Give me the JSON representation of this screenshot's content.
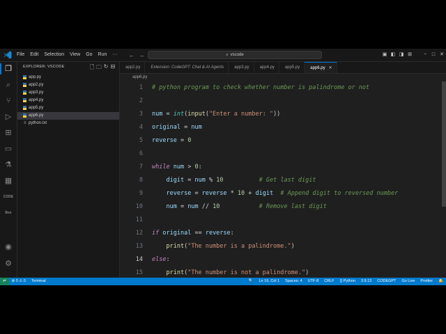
{
  "titlebar": {
    "menu": [
      "File",
      "Edit",
      "Selection",
      "View",
      "Go",
      "Run",
      "···"
    ],
    "search_text": "vscode",
    "nav_back": "←",
    "nav_forward": "→"
  },
  "activity_bar": {
    "icons": [
      "explorer-icon",
      "search-icon",
      "source-control-icon",
      "run-debug-icon",
      "extensions-icon",
      "remote-explorer-icon",
      "testing-icon",
      "docker-icon",
      "codegpt-icon",
      "chat-icon",
      "accounts-icon",
      "manage-icon"
    ],
    "codegpt_label": "CODE",
    "badge_label": "Bee"
  },
  "sidebar": {
    "header": "EXPLORER: VSCODE",
    "files": [
      {
        "name": "app.py",
        "type": "py"
      },
      {
        "name": "app2.py",
        "type": "py"
      },
      {
        "name": "app3.py",
        "type": "py"
      },
      {
        "name": "app4.py",
        "type": "py"
      },
      {
        "name": "app5.py",
        "type": "py"
      },
      {
        "name": "app6.py",
        "type": "py",
        "selected": true
      },
      {
        "name": "python.txt",
        "type": "txt"
      }
    ]
  },
  "tabs": [
    {
      "label": "app2.py"
    },
    {
      "label": "Extension: CodeGPT: Chat & AI Agents"
    },
    {
      "label": "app3.py"
    },
    {
      "label": "app4.py"
    },
    {
      "label": "app5.py"
    },
    {
      "label": "app6.py",
      "active": true
    }
  ],
  "breadcrumb": "app6.py",
  "editor": {
    "line_numbers": [
      "1",
      "2",
      "3",
      "4",
      "5",
      "6",
      "7",
      "8",
      "9",
      "10",
      "11",
      "12",
      "13",
      "14",
      "15"
    ],
    "current_line": "14"
  },
  "statusbar": {
    "remote": "⇌",
    "problems": "⊗ 0 ⚠ 0",
    "terminal": "Terminal",
    "zoom": "🔍",
    "position": "Ln 16, Col 1",
    "spaces": "Spaces: 4",
    "encoding": "UTF-8",
    "eol": "CRLF",
    "language": "{} Python",
    "version": "3.9.13",
    "codegpt": "CODEGPT",
    "golive": "Go Live",
    "prettier": "Prettier",
    "bell": "🔔"
  },
  "colors": {
    "accent": "#007acc",
    "keyword": "#c586c0",
    "comment": "#6a9955",
    "string": "#ce9178"
  }
}
